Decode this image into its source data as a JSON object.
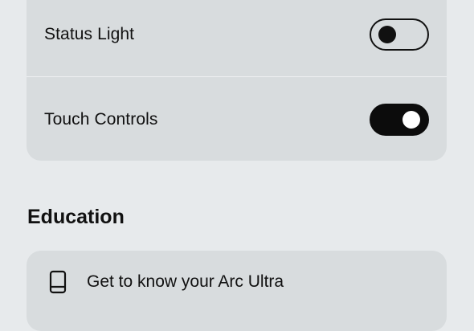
{
  "settings": {
    "rows": [
      {
        "label": "Status Light",
        "toggle_state": "off"
      },
      {
        "label": "Touch Controls",
        "toggle_state": "on"
      }
    ]
  },
  "education": {
    "heading": "Education",
    "items": [
      {
        "label": "Get to know your Arc Ultra",
        "icon": "speaker-device-icon"
      }
    ]
  },
  "colors": {
    "background": "#e7eaec",
    "card": "#d8dcde",
    "toggle_on": "#0c0c0c",
    "text": "#111111"
  }
}
